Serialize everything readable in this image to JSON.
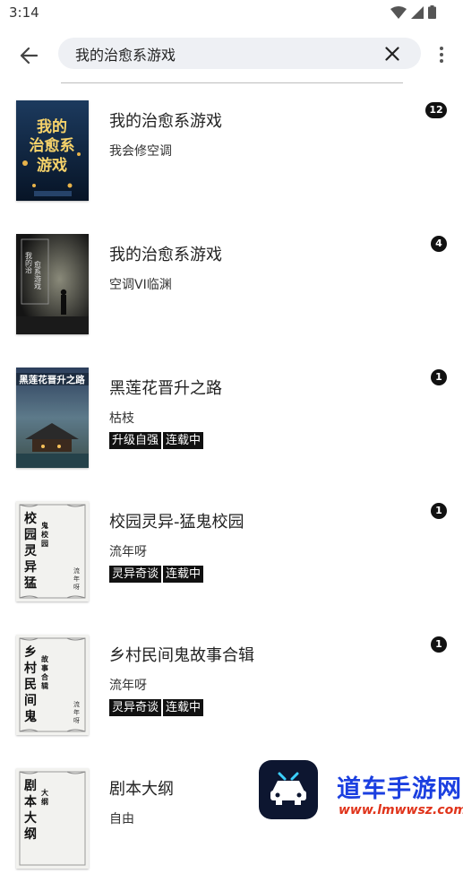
{
  "status_bar": {
    "time": "3:14"
  },
  "search": {
    "query": "我的治愈系游戏"
  },
  "books": [
    {
      "title": "我的治愈系游戏",
      "author": "我会修空调",
      "tags": [],
      "badge": "12",
      "cover_text": "我的治愈系游戏"
    },
    {
      "title": "我的治愈系游戏",
      "author": "空调VI临渊",
      "tags": [],
      "badge": "4",
      "cover_text": "我的治愈系游戏"
    },
    {
      "title": "黑莲花晋升之路",
      "author": "枯枝",
      "tags": [
        "升级自强",
        "连载中"
      ],
      "badge": "1",
      "cover_text": "黑莲花晋升之路"
    },
    {
      "title": "校园灵异-猛鬼校园",
      "author": "流年呀",
      "tags": [
        "灵异奇谈",
        "连载中"
      ],
      "badge": "1",
      "cover_text": "校园灵异猛"
    },
    {
      "title": "乡村民间鬼故事合辑",
      "author": "流年呀",
      "tags": [
        "灵异奇谈",
        "连载中"
      ],
      "badge": "1",
      "cover_text": "乡村民间鬼"
    },
    {
      "title": "剧本大纲",
      "author": "自由",
      "tags": [],
      "badge": "",
      "cover_text": "剧本大纲"
    }
  ],
  "watermark": {
    "title": "道车手游网",
    "url": "www.lmwwsz.com"
  }
}
